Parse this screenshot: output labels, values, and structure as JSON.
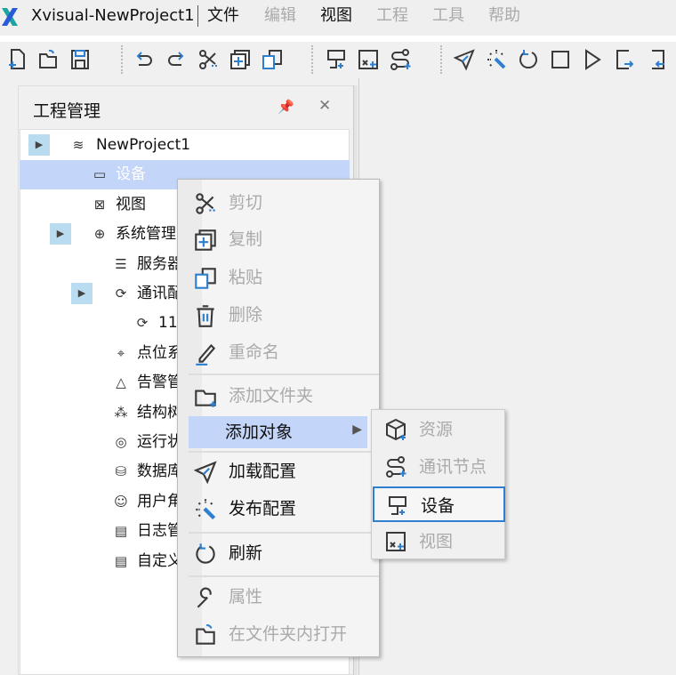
{
  "title": "Xvisual-NewProject1",
  "menubar": [
    {
      "label": "文件",
      "enabled": true
    },
    {
      "label": "编辑",
      "enabled": false
    },
    {
      "label": "视图",
      "enabled": true
    },
    {
      "label": "工程",
      "enabled": false
    },
    {
      "label": "工具",
      "enabled": false
    },
    {
      "label": "帮助",
      "enabled": false
    }
  ],
  "toolbar": [
    "new-file-icon",
    "open-folder-icon",
    "save-icon",
    "undo-icon",
    "redo-icon",
    "cut-icon",
    "copy-icon",
    "paste-icon",
    "add-device-icon",
    "add-view-icon",
    "add-comm-node-icon",
    "load-config-icon",
    "publish-config-icon",
    "refresh-icon",
    "stop-icon",
    "run-icon",
    "export-icon",
    "import-icon"
  ],
  "panel": {
    "title": "工程管理",
    "pin_icon": "pin-icon",
    "close_icon": "close-icon"
  },
  "tree": [
    {
      "label": "NewProject1",
      "icon": "layers-icon",
      "expander": true
    },
    {
      "label": "设备",
      "icon": "device-icon",
      "selected": true
    },
    {
      "label": "视图",
      "icon": "view-icon"
    },
    {
      "label": "系统管理",
      "icon": "globe-icon",
      "expander": true
    },
    {
      "label": "服务器",
      "icon": "server-icon"
    },
    {
      "label": "通讯配",
      "icon": "comm-icon",
      "expander": true
    },
    {
      "label": "11",
      "icon": "comm-node-icon"
    },
    {
      "label": "点位系",
      "icon": "location-icon"
    },
    {
      "label": "告警管",
      "icon": "alarm-icon"
    },
    {
      "label": "结构树",
      "icon": "structure-icon"
    },
    {
      "label": "运行状",
      "icon": "run-status-icon"
    },
    {
      "label": "数据库",
      "icon": "database-icon"
    },
    {
      "label": "用户角",
      "icon": "user-icon"
    },
    {
      "label": "日志管",
      "icon": "log-icon"
    },
    {
      "label": "自定义",
      "icon": "custom-icon"
    }
  ],
  "context_menu": [
    {
      "label": "剪切",
      "enabled": false,
      "icon": "cut-icon"
    },
    {
      "label": "复制",
      "enabled": false,
      "icon": "copy-icon"
    },
    {
      "label": "粘贴",
      "enabled": false,
      "icon": "paste-icon"
    },
    {
      "label": "删除",
      "enabled": false,
      "icon": "trash-icon"
    },
    {
      "label": "重命名",
      "enabled": false,
      "icon": "pencil-icon"
    },
    {
      "label": "添加文件夹",
      "enabled": false,
      "icon": "add-folder-icon"
    },
    {
      "label": "添加对象",
      "enabled": true,
      "submenu": true,
      "highlighted": true
    },
    {
      "label": "加载配置",
      "enabled": true,
      "icon": "send-icon"
    },
    {
      "label": "发布配置",
      "enabled": true,
      "icon": "publish-icon"
    },
    {
      "label": "刷新",
      "enabled": true,
      "icon": "refresh-icon"
    },
    {
      "label": "属性",
      "enabled": false,
      "icon": "wrench-icon"
    },
    {
      "label": "在文件夹内打开",
      "enabled": false,
      "icon": "open-folder-icon"
    }
  ],
  "submenu": [
    {
      "label": "资源",
      "enabled": false,
      "icon": "resource-icon"
    },
    {
      "label": "通讯节点",
      "enabled": false,
      "icon": "comm-node-icon"
    },
    {
      "label": "设备",
      "enabled": true,
      "focused": true,
      "icon": "device-icon"
    },
    {
      "label": "视图",
      "enabled": false,
      "icon": "view-icon"
    }
  ],
  "colors": {
    "selection": "#c3d5f8",
    "accent": "#2f7fd0",
    "expander": "#b9dcf0"
  }
}
